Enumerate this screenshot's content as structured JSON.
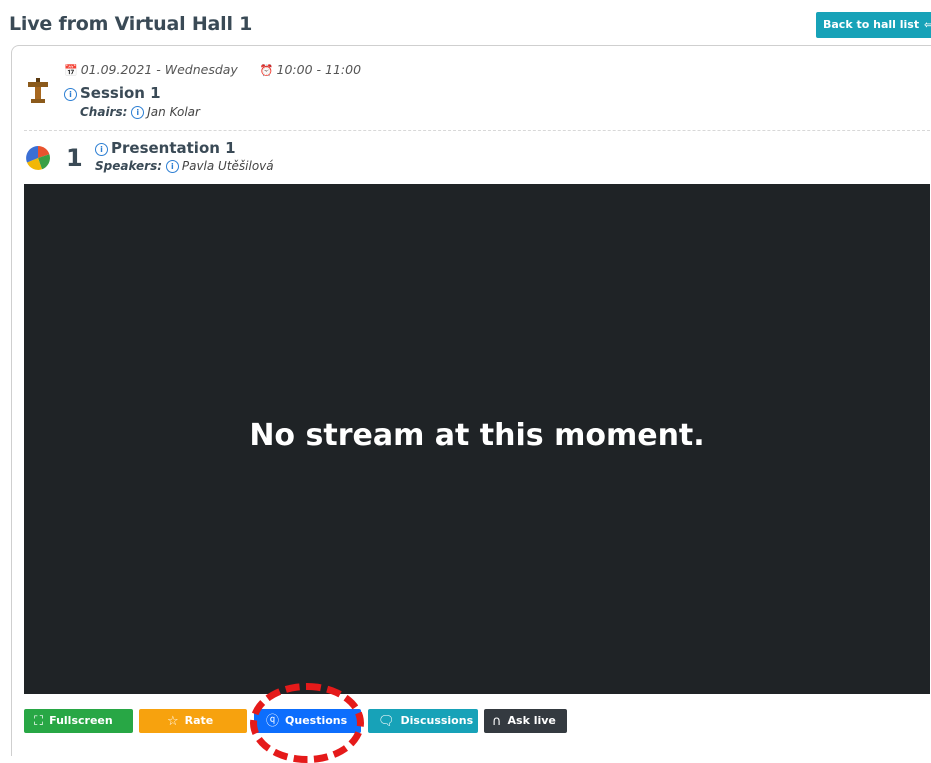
{
  "header": {
    "title": "Live from Virtual Hall 1",
    "back_label": "Back to hall list"
  },
  "session": {
    "date": "01.09.2021 - Wednesday",
    "time": "10:00 - 11:00",
    "title": "Session 1",
    "chairs_label": "Chairs:",
    "chairs": "Jan Kolar"
  },
  "presentation": {
    "number": "1",
    "title": "Presentation 1",
    "speakers_label": "Speakers:",
    "speakers": "Pavla Utěšilová"
  },
  "stream": {
    "message": "No stream at this moment."
  },
  "actions": {
    "fullscreen": "Fullscreen",
    "rate": "Rate",
    "questions": "Questions",
    "discussions": "Discussions",
    "ask_live": "Ask live"
  },
  "colors": {
    "fullscreen": "#28a745",
    "rate": "#f7a20e",
    "questions": "#0d6efd",
    "discussions": "#17a2b8",
    "ask_live": "#343a40",
    "highlight": "#e51a1a"
  }
}
